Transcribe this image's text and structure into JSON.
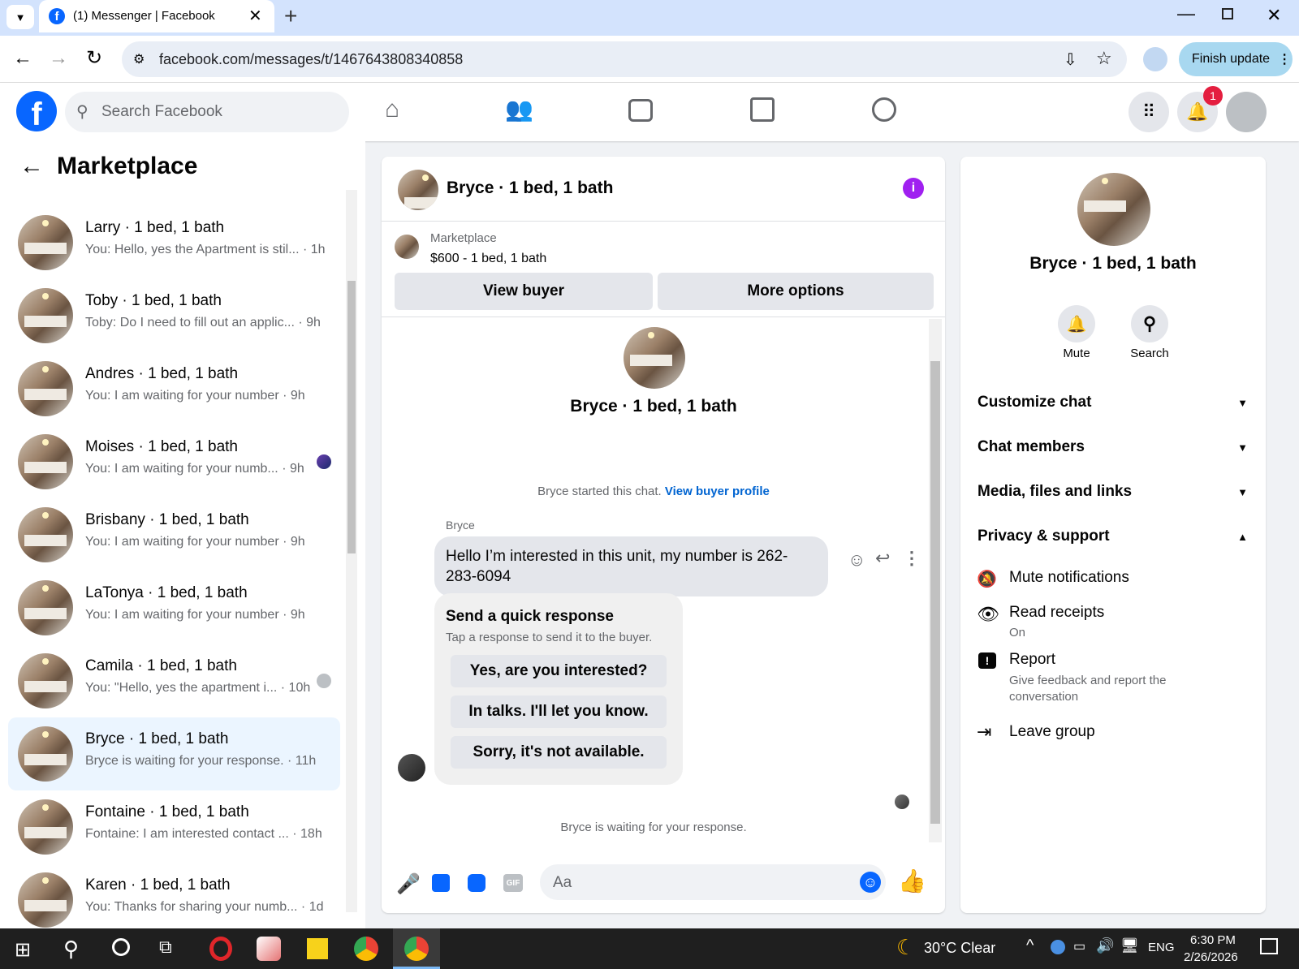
{
  "browser": {
    "tab_title": "(1) Messenger | Facebook",
    "url": "facebook.com/messages/t/1467643808340858",
    "finish_update": "Finish update"
  },
  "fb": {
    "search_placeholder": "Search Facebook",
    "notification_count": "1",
    "brand_color": "#0866ff"
  },
  "left": {
    "title": "Marketplace",
    "conversations": [
      {
        "name": "Larry · 1 bed, 1 bath",
        "preview": "You: Hello, yes the Apartment is stil... · 1h"
      },
      {
        "name": "Toby · 1 bed, 1 bath",
        "preview": "Toby: Do I need to fill out an applic... · 9h"
      },
      {
        "name": "Andres · 1 bed, 1 bath",
        "preview": "You: I am waiting for your number · 9h"
      },
      {
        "name": "Moises · 1 bed, 1 bath",
        "preview": "You: I am waiting for your numb... · 9h"
      },
      {
        "name": "Brisbany · 1 bed, 1 bath",
        "preview": "You: I am waiting for your number · 9h"
      },
      {
        "name": "LaTonya · 1 bed, 1 bath",
        "preview": "You: I am waiting for your number · 9h"
      },
      {
        "name": "Camila · 1 bed, 1 bath",
        "preview": "You: \"Hello, yes the apartment i... · 10h"
      },
      {
        "name": "Bryce · 1 bed, 1 bath",
        "preview": "Bryce is waiting for your response. · 11h"
      },
      {
        "name": "Fontaine · 1 bed, 1 bath",
        "preview": "Fontaine: I am interested contact ... · 18h"
      },
      {
        "name": "Karen · 1 bed, 1 bath",
        "preview": "You: Thanks for sharing your numb... · 1d"
      }
    ]
  },
  "chat": {
    "title": "Bryce · 1 bed, 1 bath",
    "listing_source": "Marketplace",
    "listing": "$600 - 1 bed, 1 bath",
    "view_buyer": "View buyer",
    "more_options": "More options",
    "intro_name": "Bryce · 1 bed, 1 bath",
    "started_text": "Bryce started this chat.",
    "view_buyer_profile": "View buyer profile",
    "sender": "Bryce",
    "message": "Hello I’m interested in this unit, my number is 262-283-6094",
    "quick_title": "Send a quick response",
    "quick_sub": "Tap a response to send it to the buyer.",
    "quick_responses": [
      "Yes, are you interested?",
      "In talks. I'll let you know.",
      "Sorry, it's not available."
    ],
    "waiting": "Bryce is waiting for your response.",
    "composer_placeholder": "Aa",
    "gif_label": "GIF"
  },
  "details": {
    "name": "Bryce · 1 bed, 1 bath",
    "mute": "Mute",
    "search": "Search",
    "sections": [
      "Customize chat",
      "Chat members",
      "Media, files and links",
      "Privacy & support"
    ],
    "mute_notifications": "Mute notifications",
    "read_receipts": "Read receipts",
    "read_receipts_status": "On",
    "report": "Report",
    "report_desc": "Give feedback and report the conversation",
    "leave_group": "Leave group"
  },
  "taskbar": {
    "weather": "30°C  Clear",
    "lang": "ENG",
    "time": "6:30 PM",
    "date": "2/26/2026"
  }
}
